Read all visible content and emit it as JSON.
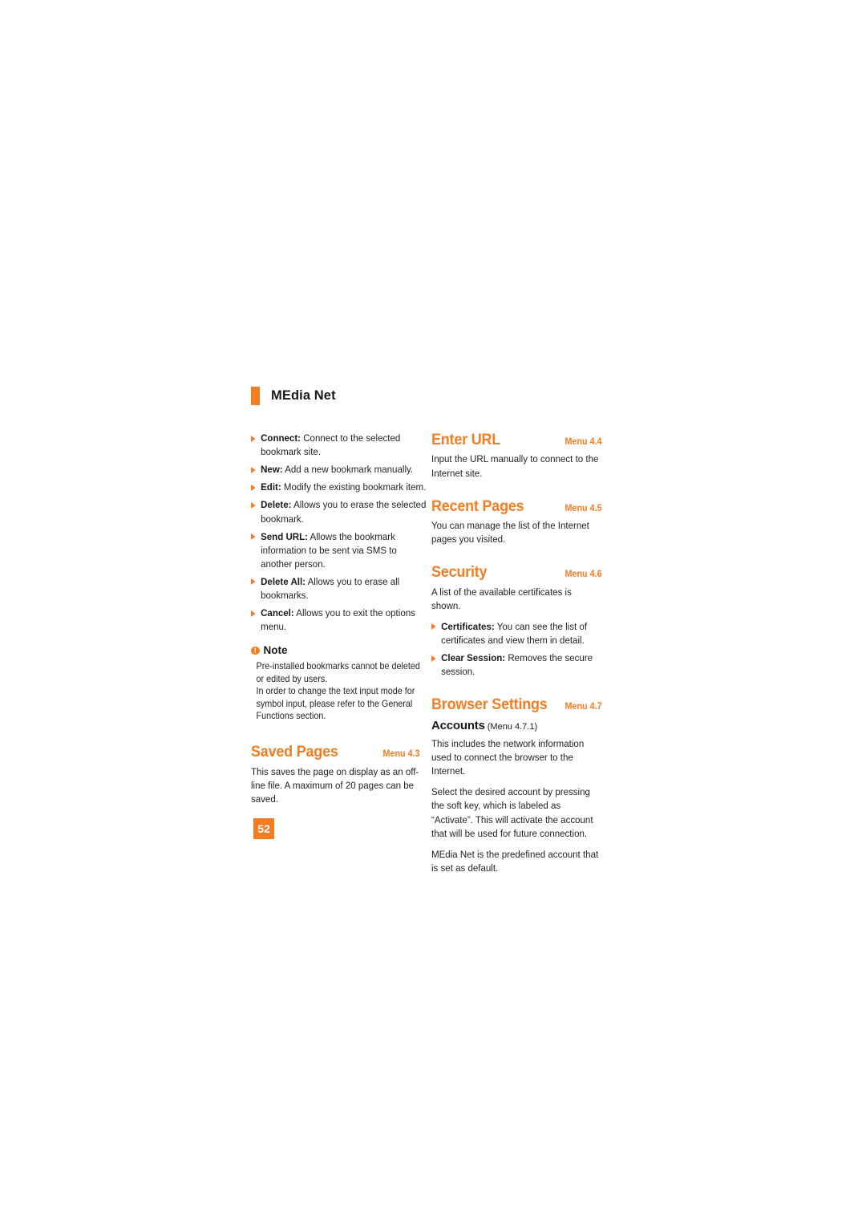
{
  "accent_color": "#F57C20",
  "text_color": "#231f20",
  "running_head": {
    "title": "MEdia Net"
  },
  "page_number": "52",
  "note": {
    "icon": "exclamation-circle-icon",
    "label": "Note",
    "lines": [
      "Pre-installed bookmarks cannot be deleted or edited by users.",
      "In order to change the text input mode for symbol input, please refer to the General Functions section."
    ]
  },
  "left_column": {
    "bookmark_options": [
      {
        "term": "Connect:",
        "desc": " Connect to the selected bookmark site."
      },
      {
        "term": "New:",
        "desc": " Add a new bookmark manually."
      },
      {
        "term": "Edit:",
        "desc": " Modify the existing bookmark item."
      },
      {
        "term": "Delete:",
        "desc": " Allows you to erase the selected bookmark."
      },
      {
        "term": "Send URL:",
        "desc": " Allows the bookmark information to be sent via SMS to another person."
      },
      {
        "term": "Delete All:",
        "desc": " Allows you to erase all bookmarks."
      },
      {
        "term": "Cancel:",
        "desc": " Allows you to exit the options menu."
      }
    ],
    "saved_pages": {
      "title": "Saved Pages",
      "menu": "Menu 4.3",
      "body": "This saves  the page on display as an off-line file. A maximum of 20 pages can be saved."
    }
  },
  "right_column": {
    "enter_url": {
      "title": "Enter URL",
      "menu": "Menu 4.4",
      "body": "Input the URL manually to connect to the Internet site."
    },
    "recent_pages": {
      "title": "Recent Pages",
      "menu": "Menu 4.5",
      "body": "You can manage the list of the Internet pages you visited."
    },
    "security": {
      "title": "Security",
      "menu": "Menu 4.6",
      "body": "A list of the available certificates is shown.",
      "items": [
        {
          "term": "Certificates:",
          "desc": " You can see the list of certificates and view them in detail."
        },
        {
          "term": "Clear Session:",
          "desc": " Removes the secure session."
        }
      ]
    },
    "browser_settings": {
      "title": "Browser Settings",
      "menu": "Menu 4.7",
      "accounts": {
        "title": "Accounts",
        "menu": "(Menu 4.7.1)",
        "paragraphs": [
          "This includes the network information used to connect the browser to the Internet.",
          "Select the desired account by pressing the soft key, which is labeled as “Activate”. This will activate the account that will be used for future connection.",
          "MEdia Net is the predefined account that is set as default."
        ]
      }
    }
  }
}
